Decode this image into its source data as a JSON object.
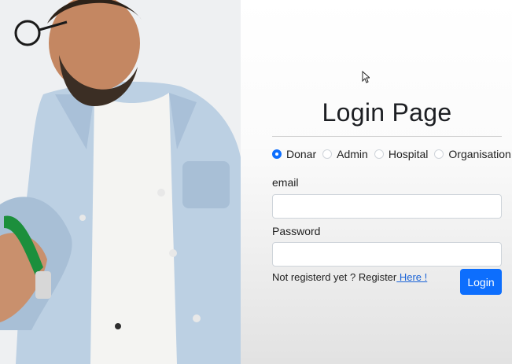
{
  "login": {
    "title": "Login Page",
    "roles": [
      "Donar",
      "Admin",
      "Hospital",
      "Organisation"
    ],
    "selected_role": "Donar",
    "email_label": "email",
    "password_label": "Password",
    "email_value": "",
    "password_value": "",
    "register_text": "Not registerd yet ? Register",
    "register_link": " Here !",
    "login_button": "Login"
  },
  "colors": {
    "accent": "#0d6efd",
    "link": "#1a63d6"
  }
}
